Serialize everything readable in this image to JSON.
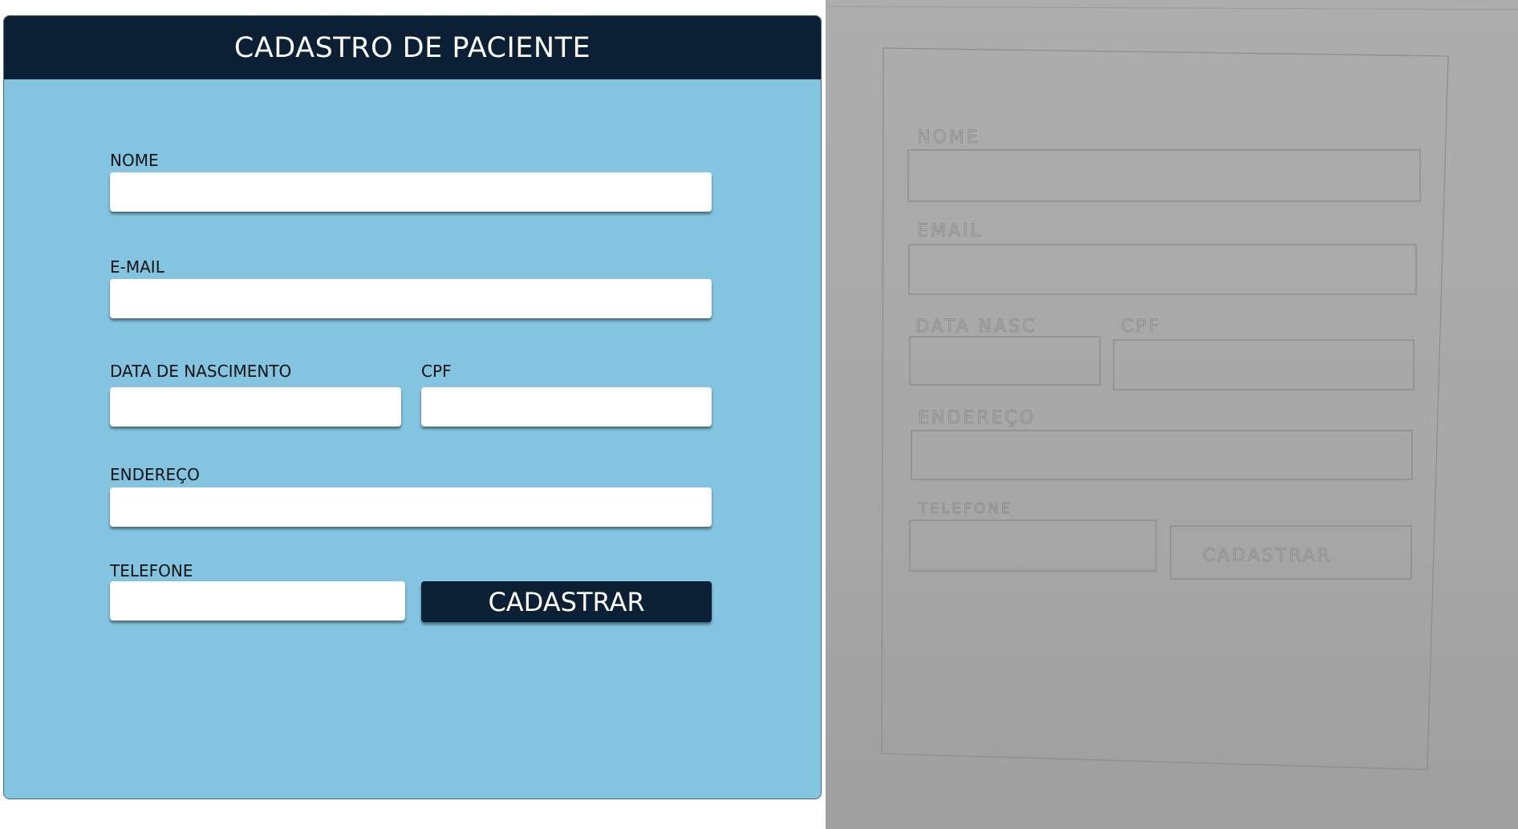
{
  "form": {
    "title": "CADASTRO DE PACIENTE",
    "fields": {
      "nome": {
        "label": "NOME",
        "value": ""
      },
      "email": {
        "label": "E-MAIL",
        "value": ""
      },
      "nascimento": {
        "label": "DATA DE NASCIMENTO",
        "value": ""
      },
      "cpf": {
        "label": "CPF",
        "value": ""
      },
      "endereco": {
        "label": "ENDEREÇO",
        "value": ""
      },
      "telefone": {
        "label": "TELEFONE",
        "value": ""
      }
    },
    "submit_label": "CADASTRAR"
  },
  "sketch": {
    "labels": {
      "nome": "NOME",
      "email": "EMAIL",
      "data": "DATA NASC",
      "cpf": "CPF",
      "endereco": "ENDEREÇO",
      "telefone": "TELEFONE",
      "button": "CADASTRAR"
    }
  },
  "colors": {
    "header": "#0b1f35",
    "card_bg": "#83c4e1",
    "button_bg": "#0b1f35",
    "field_bg": "#ffffff"
  }
}
